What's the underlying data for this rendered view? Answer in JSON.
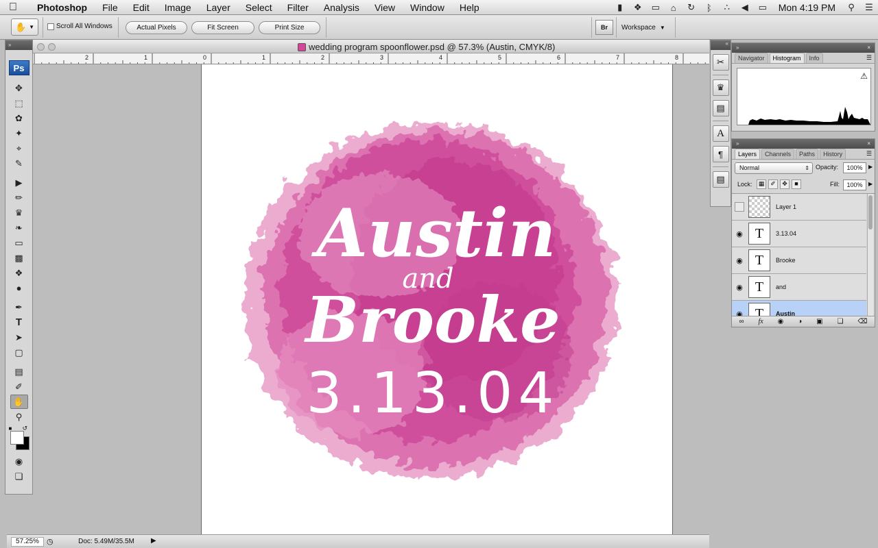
{
  "menubar": {
    "app": "Photoshop",
    "items": [
      "File",
      "Edit",
      "Image",
      "Layer",
      "Select",
      "Filter",
      "Analysis",
      "View",
      "Window",
      "Help"
    ],
    "clock": "Mon 4:19 PM"
  },
  "options_bar": {
    "scroll_all_windows": "Scroll All Windows",
    "actual_pixels": "Actual Pixels",
    "fit_screen": "Fit Screen",
    "print_size": "Print Size",
    "bridge": "Br",
    "workspace": "Workspace"
  },
  "document": {
    "title": "wedding program spoonflower.psd @ 57.3% (Austin, CMYK/8)",
    "ruler_labels": [
      "2",
      "1",
      "0",
      "1",
      "2",
      "3",
      "4",
      "5",
      "6",
      "7",
      "8"
    ],
    "artwork": {
      "name1": "Austin",
      "conj": "and",
      "name2": "Brooke",
      "date": "3.13.04"
    },
    "colors": {
      "splash": "#d04a9a",
      "splash_light": "#e792c3"
    }
  },
  "status": {
    "zoom": "57.25%",
    "doc_size": "Doc: 5.49M/35.5M"
  },
  "tools_panel": {
    "logo": "Ps"
  },
  "histogram_panel": {
    "tabs": [
      "Navigator",
      "Histogram",
      "Info"
    ],
    "active_tab": "Histogram"
  },
  "layers_panel": {
    "tabs": [
      "Layers",
      "Channels",
      "Paths",
      "History"
    ],
    "blend_mode": "Normal",
    "opacity_label": "Opacity:",
    "opacity": "100%",
    "lock_label": "Lock:",
    "fill_label": "Fill:",
    "fill": "100%",
    "layers": [
      {
        "name": "Layer 1",
        "visible": false,
        "type": "raster"
      },
      {
        "name": "3.13.04",
        "visible": true,
        "type": "text"
      },
      {
        "name": "Brooke",
        "visible": true,
        "type": "text"
      },
      {
        "name": "and",
        "visible": true,
        "type": "text"
      },
      {
        "name": "Austin",
        "visible": true,
        "type": "text",
        "selected": true
      }
    ]
  }
}
